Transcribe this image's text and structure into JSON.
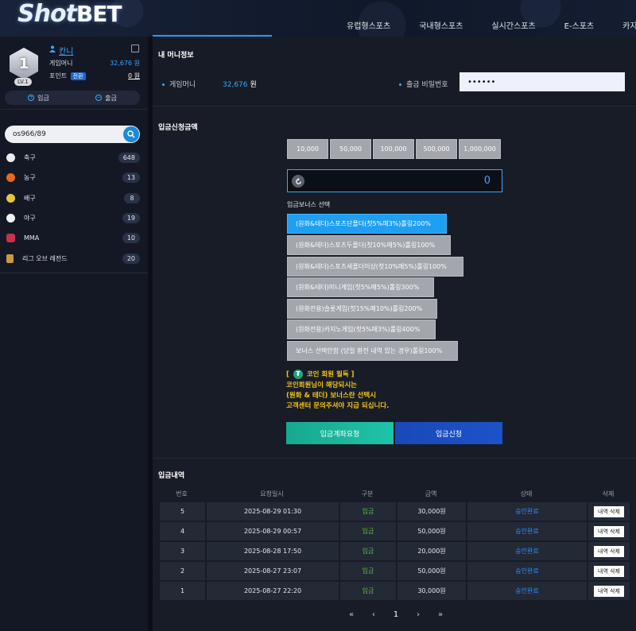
{
  "header": {
    "logo_prefix": "Shot",
    "logo_suffix": "BET",
    "nav": [
      "유럽형스포츠",
      "국내형스포츠",
      "실시간스포츠",
      "E-스포츠",
      "카지노"
    ]
  },
  "profile": {
    "level_number": "1",
    "level_label": "LV.1",
    "username": "칸니",
    "game_money_label": "게임머니",
    "game_money_value": "32,676 원",
    "point_label": "포인트",
    "switch_label": "전환",
    "point_value": "0 원",
    "deposit_label": "입금",
    "withdraw_label": "출금"
  },
  "search": {
    "value": "os966/89"
  },
  "sports": [
    {
      "name": "축구",
      "count": "648",
      "color": "#e9ecf1"
    },
    {
      "name": "농구",
      "count": "13",
      "color": "#e56a1f"
    },
    {
      "name": "배구",
      "count": "8",
      "color": "#e8c43a"
    },
    {
      "name": "야구",
      "count": "19",
      "color": "#f1f1f1"
    },
    {
      "name": "MMA",
      "count": "10",
      "color": "#c9314a"
    },
    {
      "name": "리그 오브 레전드",
      "count": "20",
      "color": "#c89b3c"
    }
  ],
  "money_info": {
    "title": "내 머니정보",
    "game_money_label": "게임머니",
    "game_money_value": "32,676",
    "game_money_unit": "원",
    "withdraw_pw_label": "출금 비밀번호",
    "withdraw_pw_value": "••••••"
  },
  "deposit": {
    "title": "입금신청금액",
    "amounts": [
      "10,000",
      "50,000",
      "100,000",
      "500,000",
      "1,000,000"
    ],
    "amount_value": "0",
    "bonus_label": "입금보너스 선택",
    "bonuses": [
      "(원화&테더)스포츠단폴더(첫5%매3%)롤링200%",
      "(원화&테더)스포츠두폴더(첫10%매5%)롤링100%",
      "(원화&테더)스포츠세폴더이상(첫10%매5%)롤링100%",
      "(원화&테더)미니게임(첫5%매5%)롤링300%",
      "(원화전용)슬롯게임(첫15%매10%)롤링200%",
      "(원화전용)카지노게임(첫5%매3%)롤링400%",
      "보너스 선택안함 (당일 환전 내역 있는 경우)롤링100%"
    ],
    "notice_line1_pre": "[",
    "notice_line1_post": "코인 회원 필독 ]",
    "notice_line2": "코인회원님이 해당되시는",
    "notice_line3": "(원화 & 테더) 보너스란 선택시",
    "notice_line4": "고객센터 문의주셔야 지급 되십니다.",
    "request_account_label": "입금계좌요청",
    "apply_label": "입금신청"
  },
  "history": {
    "title": "입금내역",
    "columns": [
      "번호",
      "요청일시",
      "구분",
      "금액",
      "상태",
      "삭제"
    ],
    "rows": [
      {
        "no": "5",
        "date": "2025-08-29 01:30",
        "type": "입금",
        "amount": "30,000원",
        "status": "승인완료",
        "delete": "내역 삭제"
      },
      {
        "no": "4",
        "date": "2025-08-29 00:57",
        "type": "입금",
        "amount": "50,000원",
        "status": "승인완료",
        "delete": "내역 삭제"
      },
      {
        "no": "3",
        "date": "2025-08-28 17:50",
        "type": "입금",
        "amount": "20,000원",
        "status": "승인완료",
        "delete": "내역 삭제"
      },
      {
        "no": "2",
        "date": "2025-08-27 23:07",
        "type": "입금",
        "amount": "50,000원",
        "status": "승인완료",
        "delete": "내역 삭제"
      },
      {
        "no": "1",
        "date": "2025-08-27 22:20",
        "type": "입금",
        "amount": "30,000원",
        "status": "승인완료",
        "delete": "내역 삭제"
      }
    ],
    "pager": {
      "first": "«",
      "prev": "‹",
      "current": "1",
      "next": "›",
      "last": "»"
    }
  }
}
